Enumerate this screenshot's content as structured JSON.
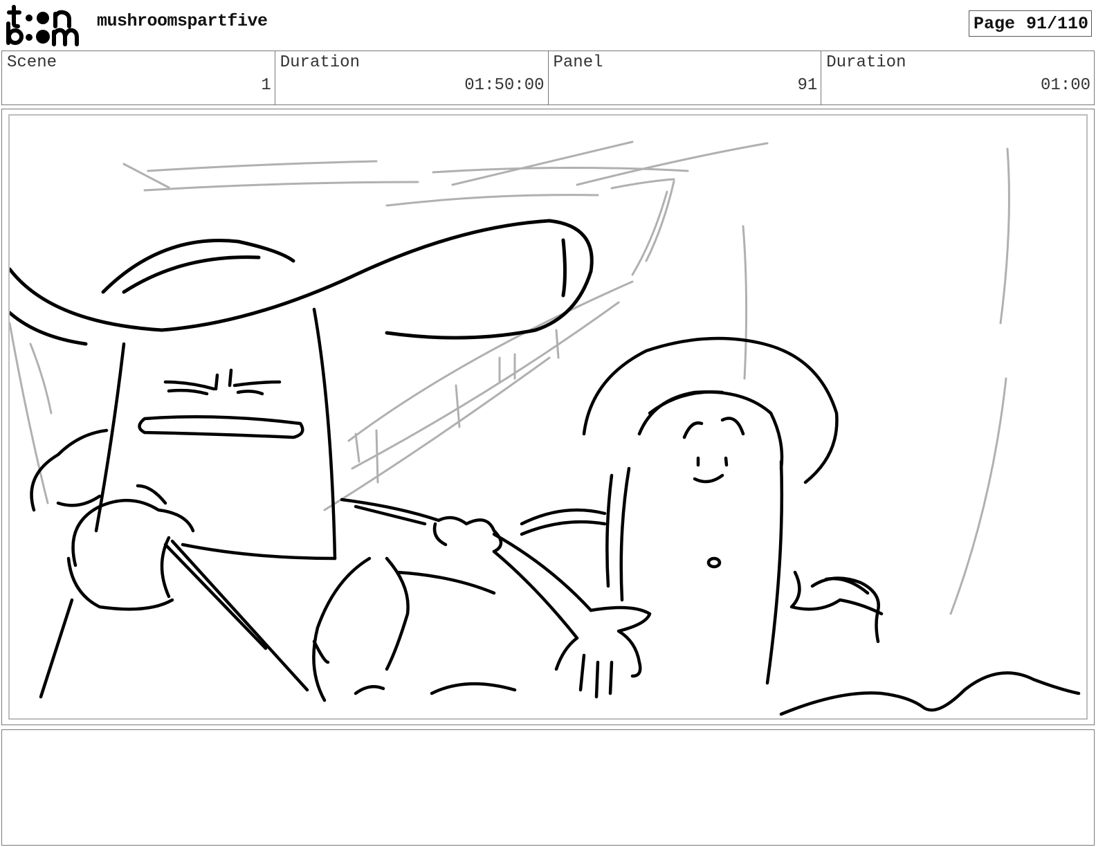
{
  "header": {
    "logo": {
      "icon": "toonboom-logo",
      "line1": "t••n",
      "line2": "b••m"
    },
    "project_title": "mushroomspartfive",
    "page": {
      "label": "Page",
      "value": "91/110"
    }
  },
  "info": {
    "scene": {
      "label": "Scene",
      "value": "1"
    },
    "scene_duration": {
      "label": "Duration",
      "value": "01:50:00"
    },
    "panel": {
      "label": "Panel",
      "value": "91"
    },
    "panel_duration": {
      "label": "Duration",
      "value": "01:00"
    }
  },
  "panel_image": {
    "icon": "storyboard-sketch"
  },
  "notes": {
    "text": ""
  }
}
